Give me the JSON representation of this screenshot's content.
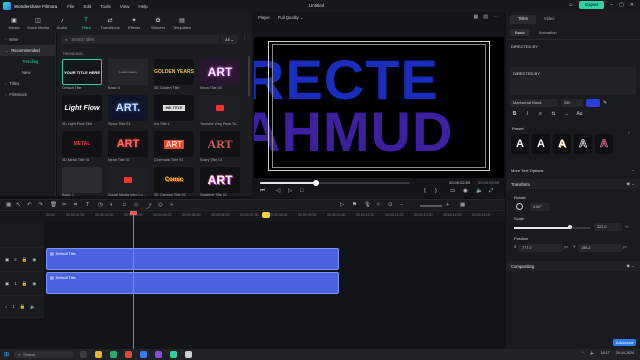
{
  "app": {
    "name": "Wondershare Filmora",
    "doc_title": "Untitled",
    "export_label": "Export"
  },
  "menu": [
    "File",
    "Edit",
    "Tools",
    "View",
    "Help"
  ],
  "media_tabs": [
    {
      "label": "Media",
      "icon": "media-icon"
    },
    {
      "label": "Stock Media",
      "icon": "stock-media-icon"
    },
    {
      "label": "Audio",
      "icon": "audio-icon"
    },
    {
      "label": "Titles",
      "icon": "titles-icon",
      "active": true
    },
    {
      "label": "Transitions",
      "icon": "transitions-icon"
    },
    {
      "label": "Effects",
      "icon": "effects-icon"
    },
    {
      "label": "Stickers",
      "icon": "stickers-icon"
    },
    {
      "label": "Templates",
      "icon": "templates-icon"
    }
  ],
  "categories": {
    "mine": "Mine",
    "recommended": "Recommended",
    "trending": "Trending",
    "new": "New",
    "titles": "Titles",
    "filmstock": "Filmstock"
  },
  "assets": {
    "search_placeholder": "Search titles",
    "filter": "All",
    "section": "TRENDING",
    "tiles": [
      {
        "caption": "Default Title",
        "text": "YOUR TITLE HERE"
      },
      {
        "caption": "Basic 6",
        "text": "Lorem ipsum"
      },
      {
        "caption": "3D Golden Title",
        "text": "GOLDEN YEARS"
      },
      {
        "caption": "Neon Title 08",
        "text": "ART"
      },
      {
        "caption": "3D Light Flow Title",
        "text": "Light Flow"
      },
      {
        "caption": "Stove Title 01",
        "text": "ART."
      },
      {
        "caption": "Ink Title 1",
        "text": "INK TITLE"
      },
      {
        "caption": "Youtube Vlog Pack Tit...",
        "text": ""
      },
      {
        "caption": "3D Metal Title 01",
        "text": "METAL"
      },
      {
        "caption": "Neon Title 07",
        "text": "ART"
      },
      {
        "caption": "Cinematic Title 01",
        "text": "ART"
      },
      {
        "caption": "Scary Title 01",
        "text": "ART"
      },
      {
        "caption": "Basic 1",
        "text": ""
      },
      {
        "caption": "Social Media Intro Lo...",
        "text": ""
      },
      {
        "caption": "3D Cartoon Title 02",
        "text": "Comic"
      },
      {
        "caption": "Gradient Title 01",
        "text": "ART"
      }
    ]
  },
  "player": {
    "label": "Player",
    "quality": "Full Quality",
    "canvas_line1": "RECTE",
    "canvas_line2": "AHMUD",
    "timecode": "00:00:02:59",
    "duration": "00:00:09:59",
    "progress": 0.37
  },
  "inspector": {
    "tab_titles": "Titles",
    "tab_video": "Video",
    "sub_basic": "Basic",
    "sub_animation": "Animation",
    "text_label": "DIRECTED BY",
    "text_value": "DIRECTED BY",
    "font": "Montserrat Black",
    "font_size": "250",
    "preset_label": "Preset",
    "preset_glyph": "A",
    "more_options": "More Text Options",
    "transform": "Transform",
    "rotate_label": "Rotate",
    "rotate_value": "0.00°",
    "scale_label": "Scale",
    "scale_value": "222.0",
    "scale_unit": "%",
    "scale_fraction": 0.74,
    "position_label": "Position",
    "pos_x_label": "X",
    "pos_x": "777.0",
    "pos_y_label": "Y",
    "pos_y": "155.2",
    "pos_unit": "px",
    "compositing": "Compositing",
    "advanced": "Advanced"
  },
  "timeline": {
    "ruler": [
      "00:00",
      "00:00:01:00",
      "00:00:02:00",
      "00:00:03:00",
      "00:00:04:00",
      "00:00:05:00",
      "00:00:06:00",
      "00:00:07:00",
      "00:00:08:00",
      "00:00:09:00",
      "00:00:10:00",
      "00:00:11:00",
      "00:00:12:00",
      "00:00:13:00",
      "00:00:14:00",
      "00:00:15:00"
    ],
    "clips": [
      "Default Title",
      "Default Title"
    ],
    "track_ids": [
      "2",
      "1",
      "1"
    ]
  },
  "taskbar": {
    "search": "Search",
    "time": "18:17",
    "date": "29-04-2024"
  },
  "colors": {
    "accent": "#2fd1a6",
    "clip": "#4a63e0",
    "playhead": "#ff5a5a"
  }
}
